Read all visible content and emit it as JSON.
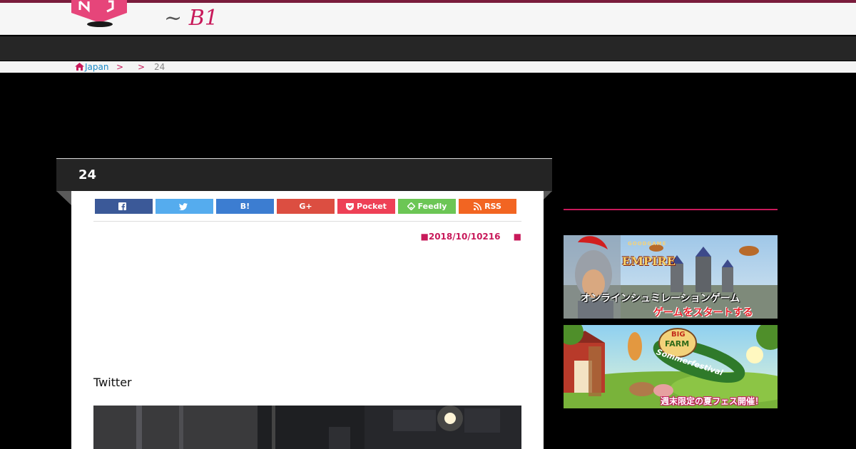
{
  "header": {
    "logo_text_prefix": "~ ",
    "logo_text_main": "B1"
  },
  "breadcrumb": {
    "home": "Japan",
    "sep1": ">",
    "sep2": ">",
    "current": "24"
  },
  "article": {
    "title": "24",
    "date": "■2018/10/10216",
    "date_suffix": "■",
    "twitter_heading": "Twitter"
  },
  "share": {
    "facebook": "",
    "twitter": "",
    "hatena": "B!",
    "googleplus": "G+",
    "pocket": "Pocket",
    "feedly": "Feedly",
    "rss": "RSS"
  },
  "ads": {
    "empire": {
      "brand": "GOODGAME",
      "title": "EMPIRE",
      "line1": "オンラインシュミレーションゲーム",
      "line2": "ゲームをスタートする"
    },
    "farm": {
      "brand1": "BIG",
      "brand2": "FARM",
      "ribbon": "Sommerfestival",
      "line1": "週末限定の夏フェス開催！"
    }
  },
  "colors": {
    "accent": "#c8195a",
    "facebook": "#3b5998",
    "twitter": "#55acee",
    "hatena": "#3c7dd1",
    "googleplus": "#dc4e41",
    "pocket": "#ee4056",
    "feedly": "#6cc655",
    "rss": "#f26522"
  }
}
